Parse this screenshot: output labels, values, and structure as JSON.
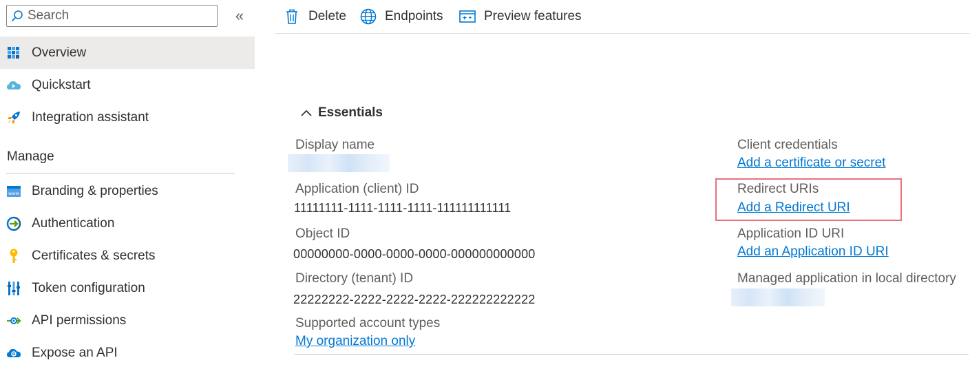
{
  "sidebar": {
    "search_placeholder": "Search",
    "collapse_label": "«",
    "items_top": [
      {
        "label": "Overview",
        "icon": "overview-grid-icon",
        "active": true
      },
      {
        "label": "Quickstart",
        "icon": "cloud-quickstart-icon"
      },
      {
        "label": "Integration assistant",
        "icon": "rocket-icon"
      }
    ],
    "manage_heading": "Manage",
    "items_manage": [
      {
        "label": "Branding & properties",
        "icon": "www-branding-icon"
      },
      {
        "label": "Authentication",
        "icon": "authentication-arrow-icon"
      },
      {
        "label": "Certificates & secrets",
        "icon": "key-icon"
      },
      {
        "label": "Token configuration",
        "icon": "token-bars-icon"
      },
      {
        "label": "API permissions",
        "icon": "api-permissions-icon"
      },
      {
        "label": "Expose an API",
        "icon": "cloud-gear-icon"
      }
    ]
  },
  "commandbar": {
    "delete_label": "Delete",
    "endpoints_label": "Endpoints",
    "preview_label": "Preview features"
  },
  "essentials": {
    "title": "Essentials",
    "left": {
      "display_name_label": "Display name",
      "app_id_label": "Application (client) ID",
      "app_id_value": "11111111-1111-1111-1111-111111111111",
      "object_id_label": "Object ID",
      "object_id_value": "00000000-0000-0000-0000-000000000000",
      "tenant_id_label": "Directory (tenant) ID",
      "tenant_id_value": "22222222-2222-2222-2222-222222222222",
      "account_types_label": "Supported account types",
      "account_types_link": "My organization only"
    },
    "right": {
      "client_credentials_label": "Client credentials",
      "client_credentials_link": "Add a certificate or secret",
      "redirect_uris_label": "Redirect URIs",
      "redirect_uris_link": "Add a Redirect URI",
      "app_id_uri_label": "Application ID URI",
      "app_id_uri_link": "Add an Application ID URI",
      "managed_app_label": "Managed application in local directory"
    }
  },
  "colors": {
    "link": "#0078d4",
    "active_bg": "#edebe9",
    "highlight": "#e8727a"
  }
}
